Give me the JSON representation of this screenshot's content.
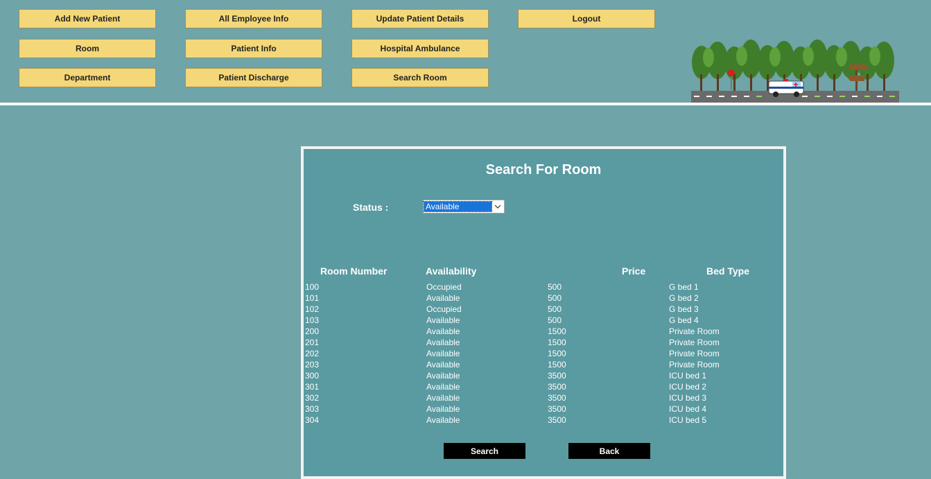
{
  "menu": {
    "add_new_patient": "Add New Patient",
    "all_employee_info": "All Employee Info",
    "update_patient_details": "Update Patient Details",
    "logout": "Logout",
    "room": "Room",
    "patient_info": "Patient Info",
    "hospital_ambulance": "Hospital Ambulance",
    "department": "Department",
    "patient_discharge": "Patient Discharge",
    "search_room": "Search Room"
  },
  "illustration": {
    "icon": "ambulance-road-trees-illustration"
  },
  "panel": {
    "title": "Search For Room",
    "status_label": "Status :",
    "status_selected": "Available",
    "columns": [
      "Room Number",
      "Availability",
      "Price",
      "Bed Type"
    ],
    "rows": [
      [
        "100",
        "Occupied",
        "500",
        "G bed 1"
      ],
      [
        "101",
        "Available",
        "500",
        "G bed 2"
      ],
      [
        "102",
        "Occupied",
        "500",
        "G bed 3"
      ],
      [
        "103",
        "Available",
        "500",
        "G bed 4"
      ],
      [
        "200",
        "Available",
        "1500",
        "Private Room"
      ],
      [
        "201",
        "Available",
        "1500",
        "Private Room"
      ],
      [
        "202",
        "Available",
        "1500",
        "Private Room"
      ],
      [
        "203",
        "Available",
        "1500",
        "Private Room"
      ],
      [
        "300",
        "Available",
        "3500",
        "ICU bed 1"
      ],
      [
        "301",
        "Available",
        "3500",
        "ICU bed 2"
      ],
      [
        "302",
        "Available",
        "3500",
        "ICU bed 3"
      ],
      [
        "303",
        "Available",
        "3500",
        "ICU bed 4"
      ],
      [
        "304",
        "Available",
        "3500",
        "ICU bed 5"
      ]
    ],
    "search_button": "Search",
    "back_button": "Back"
  },
  "colors": {
    "background": "#6fa4a9",
    "panel": "#5a9aa1",
    "menu_button": "#f4d778",
    "action_button": "#000000",
    "selection": "#1a74d8"
  }
}
